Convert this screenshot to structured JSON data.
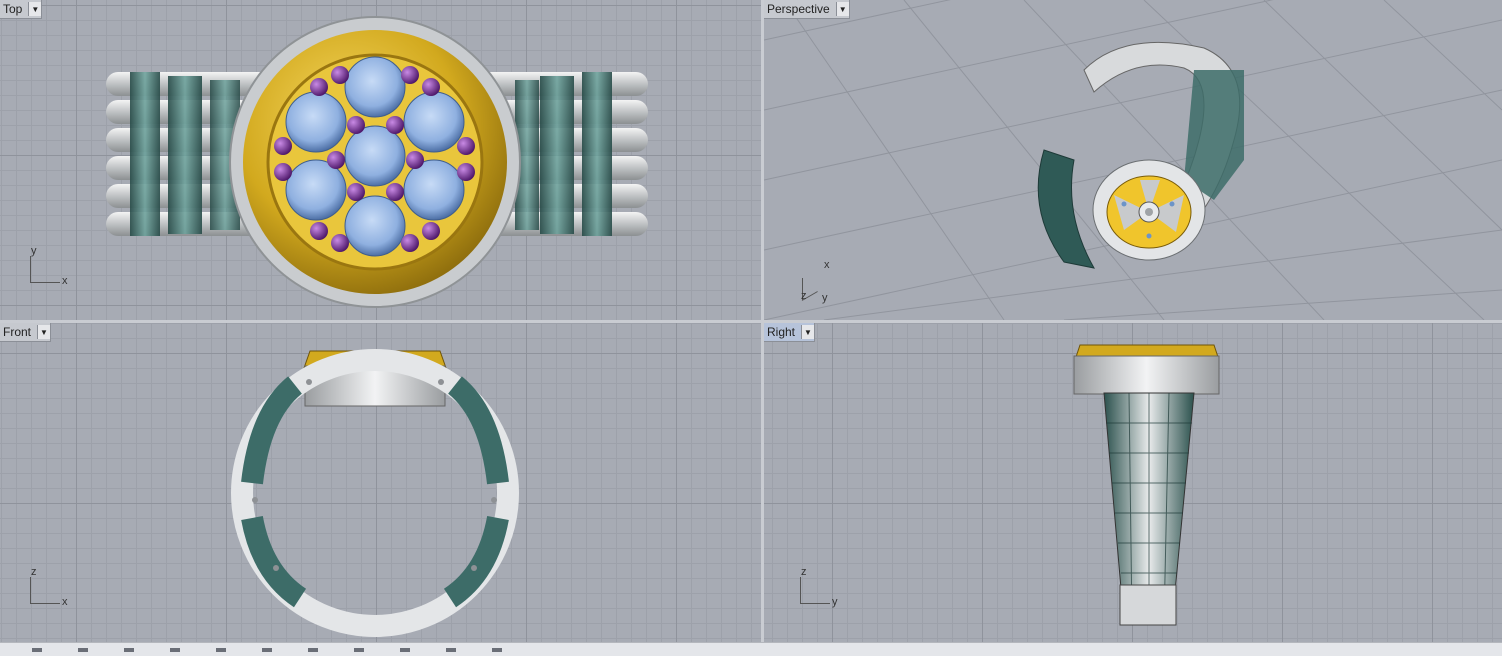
{
  "viewports": {
    "top": {
      "label": "Top",
      "axis_h": "x",
      "axis_v": "y"
    },
    "perspective": {
      "label": "Perspective",
      "axis_a": "x",
      "axis_b": "y",
      "axis_c": "z"
    },
    "front": {
      "label": "Front",
      "axis_h": "x",
      "axis_v": "z"
    },
    "right": {
      "label": "Right",
      "axis_h": "y",
      "axis_v": "z"
    }
  },
  "dropdown_icon": "triangle-down-icon",
  "colors": {
    "gold": "#d2a91e",
    "silver": "#dfe1e3",
    "teal": "#3d6c68",
    "gem_blue": "#8fb0e0",
    "amethyst": "#7c3a9e",
    "grid": "#a7abb4"
  }
}
